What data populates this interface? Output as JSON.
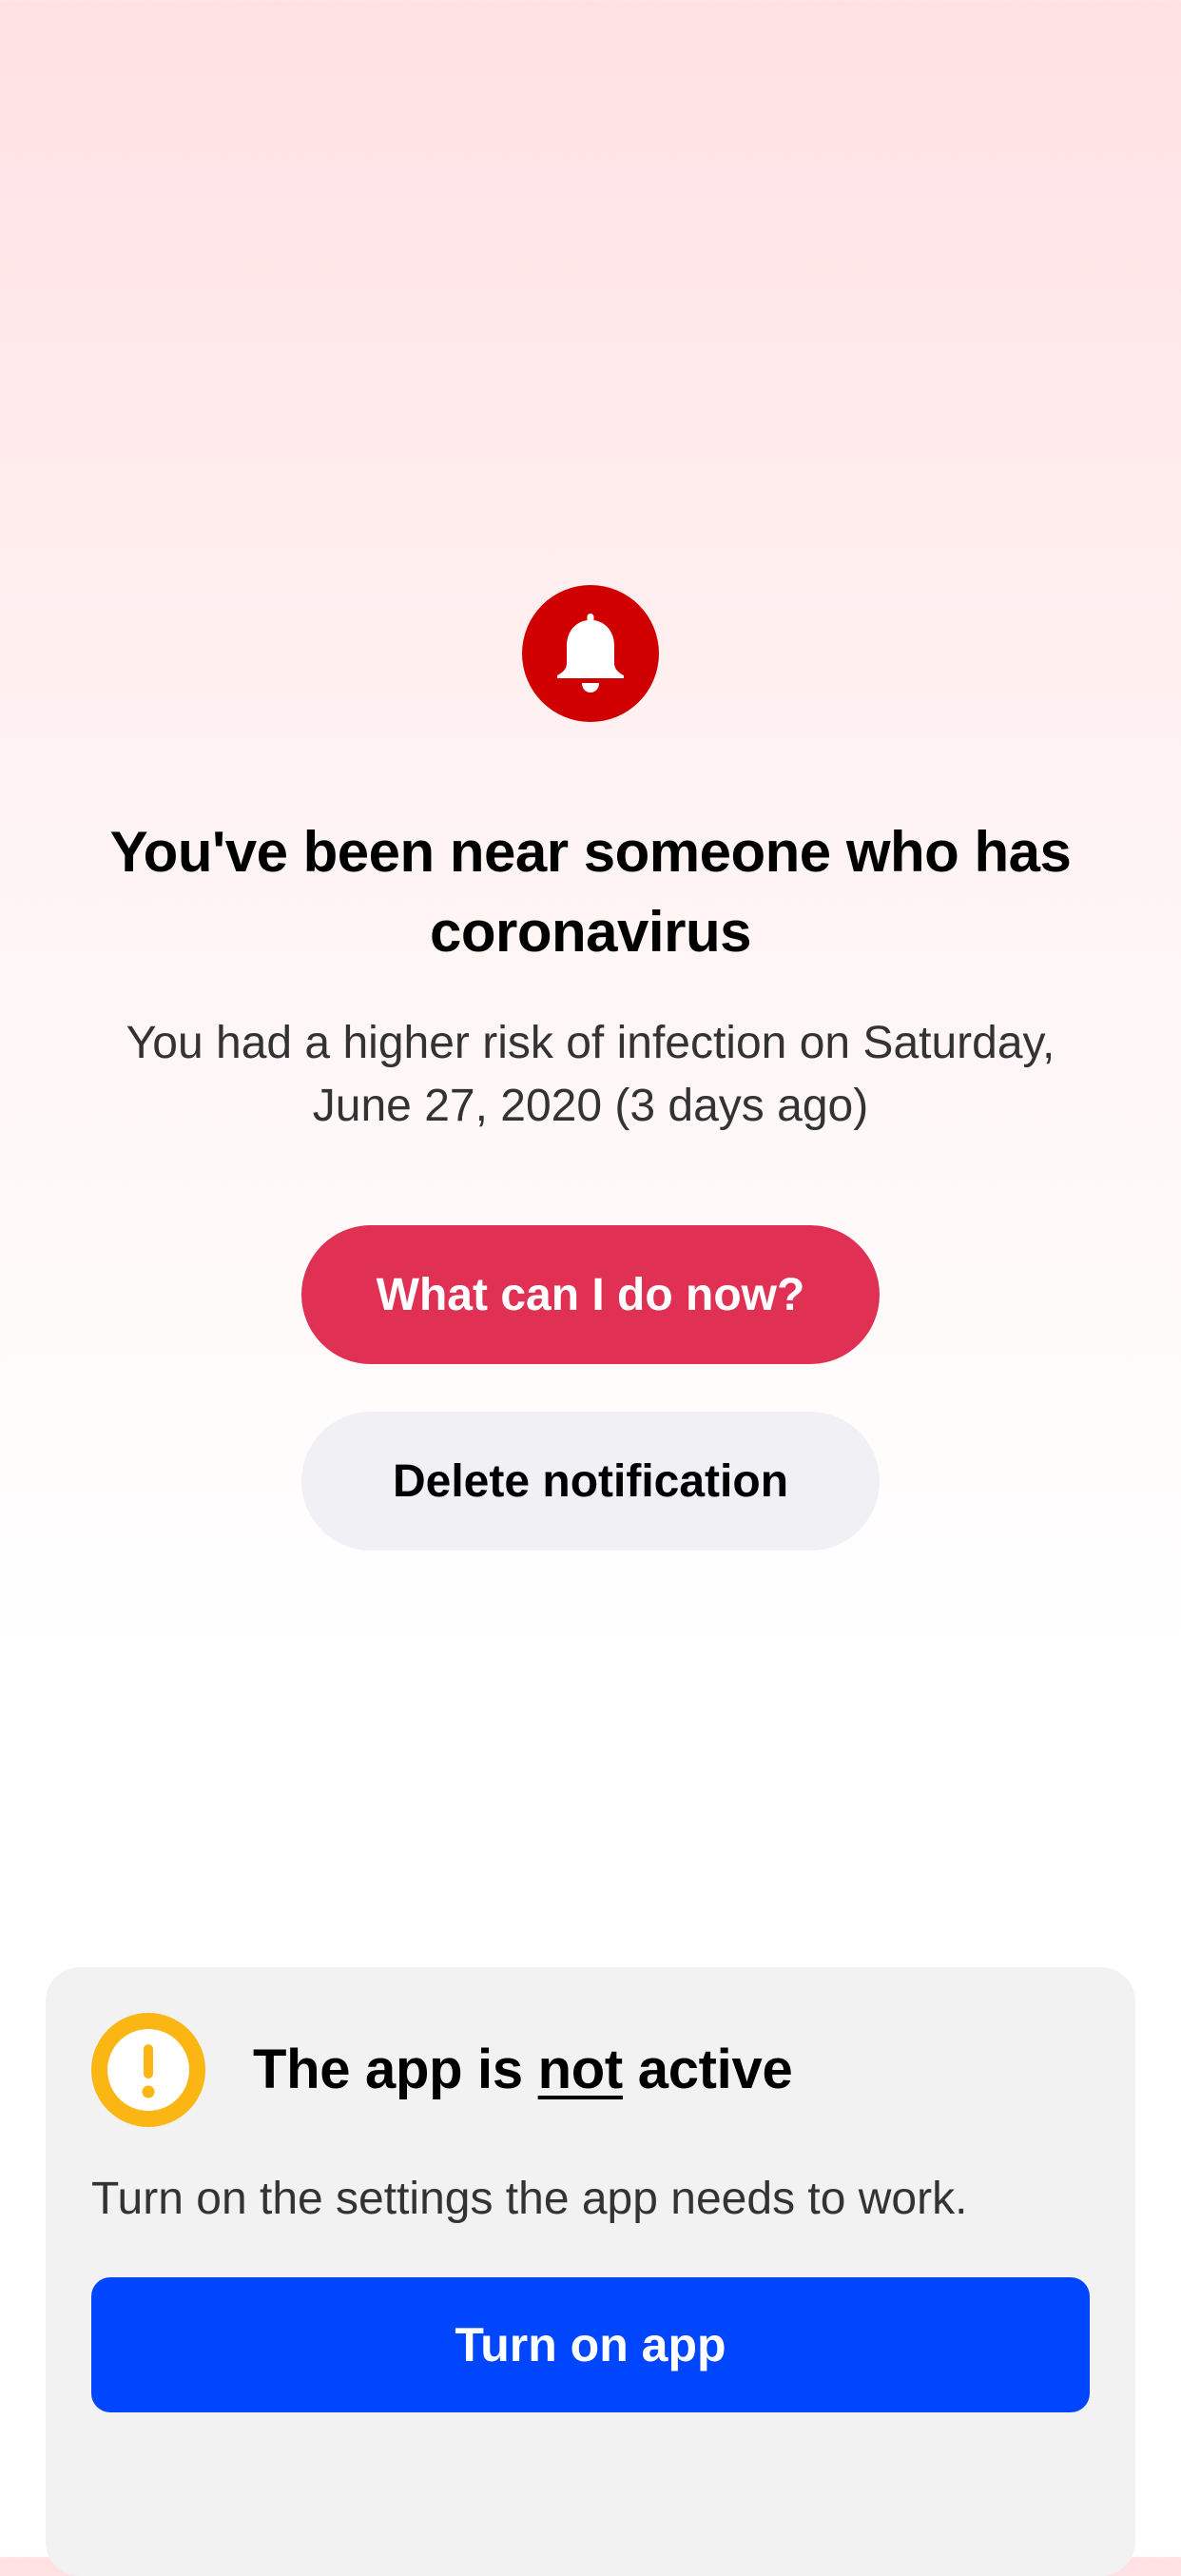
{
  "alert": {
    "icon": "bell-icon",
    "title": "You've been near someone who has coronavirus",
    "description": "You had a higher risk of infection on Saturday, June 27, 2020 (3 days ago)",
    "primary_button": "What can I do now?",
    "secondary_button": "Delete notification"
  },
  "status_card": {
    "icon": "exclamation-icon",
    "title_prefix": "The app is ",
    "title_emphasis": "not",
    "title_suffix": " active",
    "description": "Turn on the settings the app needs to work.",
    "button": "Turn on app"
  },
  "colors": {
    "alert_red": "#d10000",
    "primary_button": "#e03154",
    "secondary_button": "#f1f1f5",
    "warning_yellow": "#fbb614",
    "action_blue": "#0046fe",
    "card_background": "#f2f2f2"
  }
}
